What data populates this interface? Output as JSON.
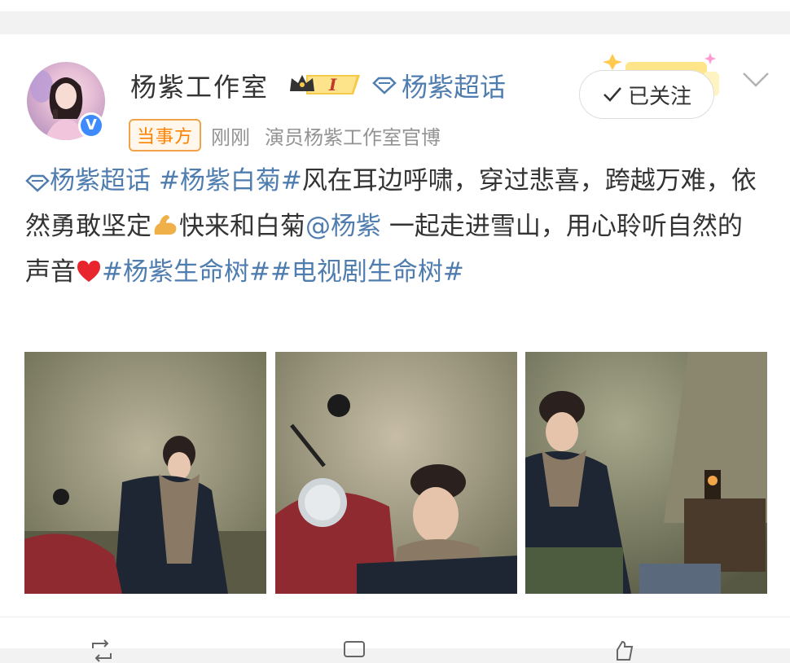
{
  "post": {
    "author": {
      "name": "杨紫工作室",
      "vip_level": "I",
      "supertopic": "杨紫超话",
      "verified": true
    },
    "follow_button": "已关注",
    "tag": "当事方",
    "time": "刚刚",
    "source": "演员杨紫工作室官博",
    "content": {
      "supertopic": "杨紫超话",
      "hashtag1": "#杨紫白菊#",
      "text1": "风在耳边呼啸，穿过悲喜，跨越万难，依然勇敢坚定",
      "text2": "快来和白菊",
      "mention": "@杨紫",
      "text3": " 一起走进雪山，用心聆听自然的声音",
      "hashtag2": "#杨紫生命树#",
      "hashtag3": "#电视剧生命树#"
    },
    "images_alt": [
      "photo-1",
      "photo-2",
      "photo-3"
    ]
  },
  "colors": {
    "link": "#507daf",
    "text": "#333333",
    "meta": "#939393",
    "tag": "#ff8200",
    "verified": "#3d8bff"
  }
}
